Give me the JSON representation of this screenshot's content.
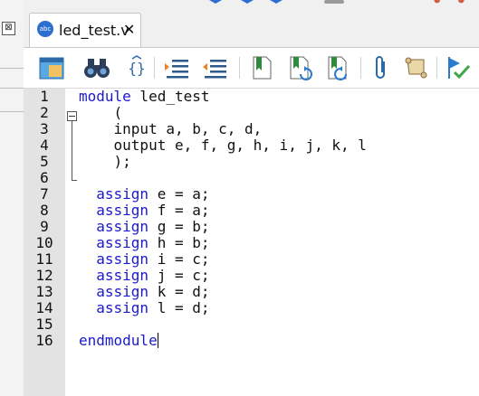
{
  "tab": {
    "file_icon_text": "abc",
    "label": "led_test.v",
    "close_glyph": "✕"
  },
  "left_panel": {
    "close_glyph": "⊠"
  },
  "toolbar": {
    "buttons": [
      {
        "name": "window-layout-icon"
      },
      {
        "name": "find-binoculars-icon"
      },
      {
        "name": "braces-icon"
      },
      {
        "name": "indent-increase-icon"
      },
      {
        "name": "indent-decrease-icon"
      },
      {
        "name": "bookmark-icon"
      },
      {
        "name": "bookmark-next-icon"
      },
      {
        "name": "bookmark-previous-icon"
      },
      {
        "name": "paperclip-icon"
      },
      {
        "name": "scroll-icon"
      },
      {
        "name": "check-flag-icon"
      }
    ]
  },
  "editor": {
    "line_numbers": [
      "1",
      "2",
      "3",
      "4",
      "5",
      "6",
      "7",
      "8",
      "9",
      "10",
      "11",
      "12",
      "13",
      "14",
      "15",
      "16"
    ],
    "lines": [
      {
        "kw": "module",
        "rest": " led_test"
      },
      {
        "kw": "",
        "rest": "    ("
      },
      {
        "kw": "",
        "rest": "    input a, b, c, d,"
      },
      {
        "kw": "",
        "rest": "    output e, f, g, h, i, j, k, l"
      },
      {
        "kw": "",
        "rest": "    );"
      },
      {
        "kw": "",
        "rest": ""
      },
      {
        "kw": "  assign",
        "rest": " e = a;"
      },
      {
        "kw": "  assign",
        "rest": " f = a;"
      },
      {
        "kw": "  assign",
        "rest": " g = b;"
      },
      {
        "kw": "  assign",
        "rest": " h = b;"
      },
      {
        "kw": "  assign",
        "rest": " i = c;"
      },
      {
        "kw": "  assign",
        "rest": " j = c;"
      },
      {
        "kw": "  assign",
        "rest": " k = d;"
      },
      {
        "kw": "  assign",
        "rest": " l = d;"
      },
      {
        "kw": "",
        "rest": ""
      },
      {
        "kw": "endmodule",
        "rest": ""
      }
    ]
  },
  "colors": {
    "keyword": "#1a1acc",
    "gutter": "#e3e3e3",
    "text": "#111111"
  }
}
